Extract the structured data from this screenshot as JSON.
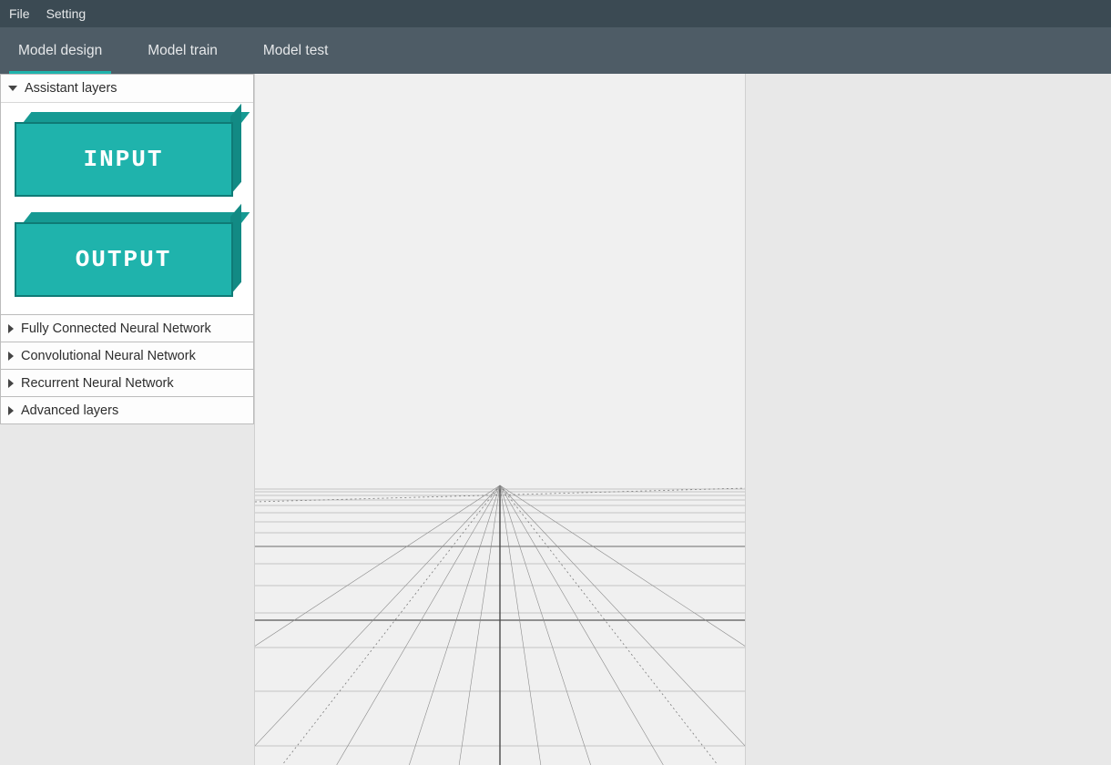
{
  "menubar": {
    "items": [
      {
        "label": "File"
      },
      {
        "label": "Setting"
      }
    ]
  },
  "tabs": [
    {
      "label": "Model design",
      "active": true
    },
    {
      "label": "Model train",
      "active": false
    },
    {
      "label": "Model test",
      "active": false
    }
  ],
  "sidebar": {
    "sections": [
      {
        "title": "Assistant layers",
        "expanded": true
      },
      {
        "title": "Fully Connected Neural Network",
        "expanded": false
      },
      {
        "title": "Convolutional Neural Network",
        "expanded": false
      },
      {
        "title": "Recurrent Neural Network",
        "expanded": false
      },
      {
        "title": "Advanced layers",
        "expanded": false
      }
    ],
    "assistant_blocks": [
      {
        "label": "INPUT"
      },
      {
        "label": "OUTPUT"
      }
    ]
  },
  "colors": {
    "menubar_bg": "#3b4a53",
    "tabbar_bg": "#4e5c66",
    "accent": "#1fb3ac",
    "block_front": "#1fb3ac",
    "block_top": "#169a93",
    "block_side": "#128a84",
    "canvas_bg": "#f0f0f0"
  }
}
